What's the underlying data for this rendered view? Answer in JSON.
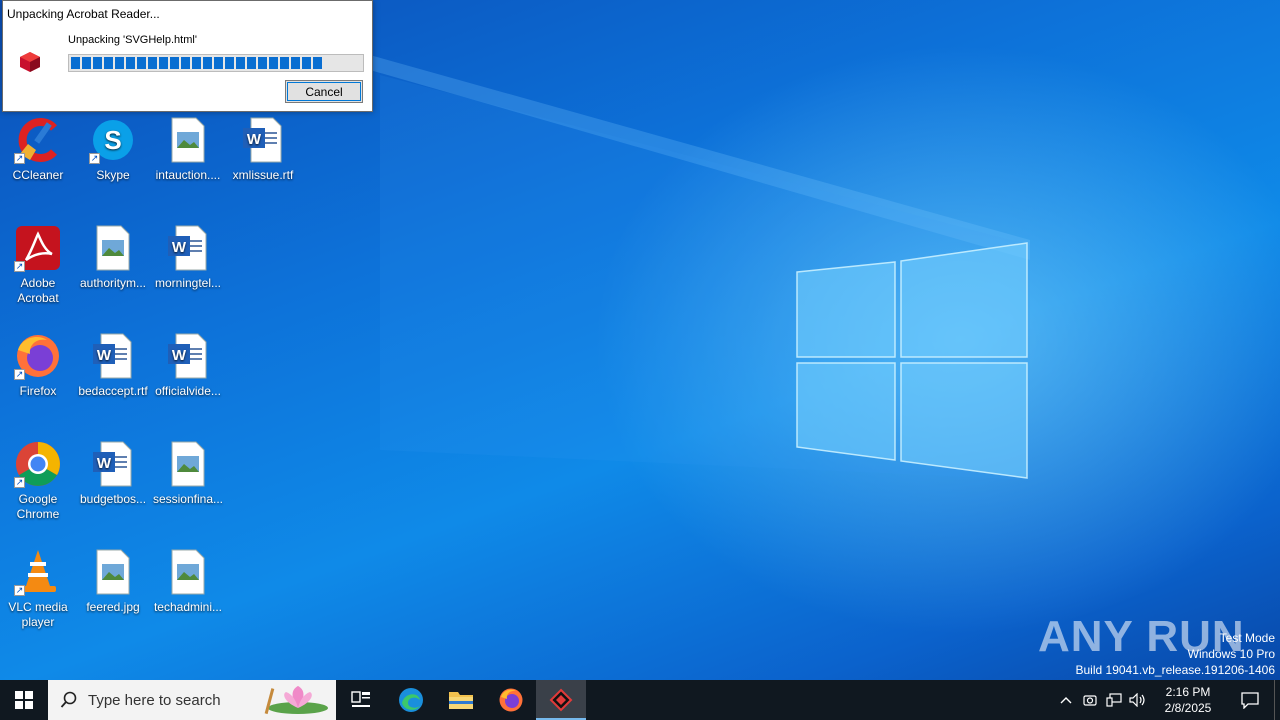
{
  "dialog": {
    "title": "Unpacking Acrobat Reader...",
    "message": "Unpacking 'SVGHelp.html'",
    "progress": 0.89,
    "cancel_label": "Cancel"
  },
  "desktop_icons": [
    {
      "label": "CCleaner",
      "icon": "ccleaner-icon"
    },
    {
      "label": "Skype",
      "icon": "skype-icon"
    },
    {
      "label": "intauction....",
      "icon": "image-file-icon"
    },
    {
      "label": "xmlissue.rtf",
      "icon": "word-document-icon"
    },
    {
      "label": "Adobe Acrobat",
      "icon": "adobe-acrobat-icon"
    },
    {
      "label": "authoritym...",
      "icon": "image-file-icon"
    },
    {
      "label": "morningtel...",
      "icon": "word-document-icon"
    },
    {
      "label": "Firefox",
      "icon": "firefox-icon"
    },
    {
      "label": "bedaccept.rtf",
      "icon": "word-document-icon"
    },
    {
      "label": "officialvide...",
      "icon": "word-document-icon"
    },
    {
      "label": "Google Chrome",
      "icon": "chrome-icon"
    },
    {
      "label": "budgetbos...",
      "icon": "word-document-icon"
    },
    {
      "label": "sessionfina...",
      "icon": "image-file-icon"
    },
    {
      "label": "VLC media player",
      "icon": "vlc-icon"
    },
    {
      "label": "feered.jpg",
      "icon": "image-file-icon"
    },
    {
      "label": "techadmini...",
      "icon": "image-file-icon"
    }
  ],
  "watermark": {
    "line1": "Test Mode",
    "line2": "Windows 10 Pro",
    "line3": "Build 19041.vb_release.191206-1406",
    "brand": "ANY RUN"
  },
  "taskbar": {
    "search_placeholder": "Type here to search",
    "time": "2:16 PM",
    "date": "2/8/2025"
  }
}
